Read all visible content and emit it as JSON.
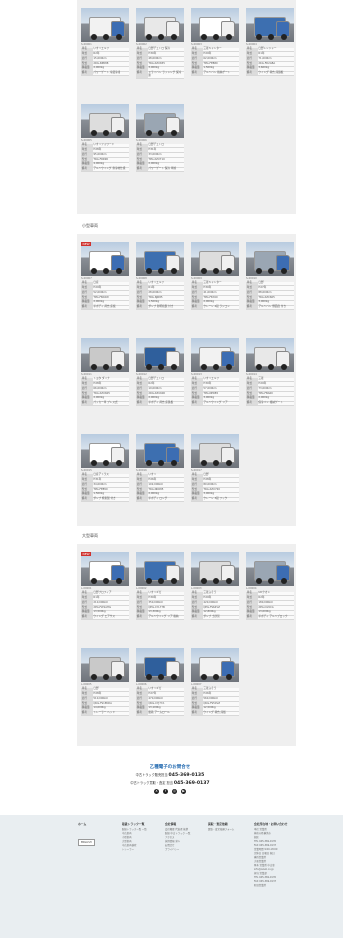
{
  "sections": {
    "used_title": "",
    "small_title": "小型車両",
    "large_title": "大型車両"
  },
  "spec_keys": [
    "車名",
    "年式",
    "走行",
    "型式",
    "積載量",
    "備考"
  ],
  "card_top": [
    {
      "id": "S-00001",
      "vals": [
        "いすゞエルフ",
        "R2年",
        "15,000km",
        "2RG-NPR88",
        "2,000kg",
        "パワーゲート 冷蔵冷凍"
      ]
    },
    {
      "id": "S-00002",
      "vals": [
        "日野デュトロ 保冷",
        "H30年",
        "48,000km",
        "TKG-XZU655",
        "3,000kg",
        "ドライバン ラッシング 保冷庫"
      ]
    },
    {
      "id": "S-00003",
      "vals": [
        "三菱キャンター",
        "H29年",
        "62,000km",
        "TPG-FEB80",
        "1,500kg",
        "アルミバン 格納ゲート"
      ]
    },
    {
      "id": "S-00004",
      "vals": [
        "日野レンジャー",
        "R1年",
        "71,000km",
        "2KG-FD2ABA",
        "3,600kg",
        "ウイング 荷台 床鉄板"
      ]
    },
    {
      "id": "S-00005",
      "vals": [
        "いすゞフォワード",
        "H28年",
        "95,000km",
        "TKG-FRR90",
        "4,000kg",
        "アルミウイング 寒冷地仕様"
      ]
    },
    {
      "id": "S-00006",
      "vals": [
        "日野デュトロ",
        "H31年",
        "33,000km",
        "TPG-XZU710",
        "2,000kg",
        "パワーゲート 保冷 車線"
      ]
    }
  ],
  "card_small": [
    {
      "id": "S-00007",
      "vals": [
        "日産",
        "H29年",
        "52,000km",
        "TPG-FBA5W",
        "2,000kg",
        "平ボディ 荷台 床板"
      ]
    },
    {
      "id": "S-00008",
      "vals": [
        "いすゞエルフ",
        "R1年",
        "28,000km",
        "TRG-NJR85",
        "1,500kg",
        "ダンプ 新明和製 付き"
      ]
    },
    {
      "id": "S-00009",
      "vals": [
        "三菱キャンター",
        "H30年",
        "41,000km",
        "TPG-FEA50",
        "2,000kg",
        "クレーン 4段 ラジコン"
      ]
    },
    {
      "id": "S-00010",
      "vals": [
        "日野",
        "H27年",
        "88,000km",
        "TKG-XZC605",
        "3,000kg",
        "アルミバン 側面扉 付き"
      ]
    },
    {
      "id": "S-00011",
      "vals": [
        "トヨタ ダイナ",
        "H28年",
        "66,000km",
        "TKG-XZU605",
        "2,000kg",
        "パッカー車 プレス式"
      ]
    },
    {
      "id": "S-00012",
      "vals": [
        "日野デュトロ",
        "R2年",
        "19,000km",
        "2RG-XZU600",
        "2,000kg",
        "平ボディ 荷台 床鉄板"
      ]
    },
    {
      "id": "S-00013",
      "vals": [
        "いすゞエルフ",
        "H30年",
        "57,000km",
        "TPG-NPR85",
        "3,000kg",
        "アルミウイング リア"
      ]
    },
    {
      "id": "S-00014",
      "vals": [
        "三菱",
        "H29年",
        "73,000km",
        "TPG-FBA60",
        "2,000kg",
        "保冷バン 格納ゲート"
      ]
    },
    {
      "id": "S-00015",
      "vals": [
        "日産アトラス",
        "H31年",
        "34,000km",
        "TPG-FEB50",
        "1,500kg",
        "ダンプ 極東製 付き"
      ]
    },
    {
      "id": "S-00016",
      "vals": [
        "いすゞ",
        "H26年",
        "102,000km",
        "TKG-NKR85",
        "2,000kg",
        "平ボディ ロング"
      ]
    },
    {
      "id": "S-00017",
      "vals": [
        "日野",
        "H28年",
        "80,000km",
        "TKG-XZU720",
        "3,000kg",
        "クレーン 3段 フック"
      ]
    }
  ],
  "card_large": [
    {
      "id": "L-00001",
      "vals": [
        "日野プロフィア",
        "R1年",
        "210,000km",
        "2PG-FW1AHG",
        "13,500kg",
        "ウイング エアサス"
      ]
    },
    {
      "id": "L-00002",
      "vals": [
        "いすゞギガ",
        "H30年",
        "350,000km",
        "QPG-CYL77B",
        "13,300kg",
        "アルミウイング リア 格納"
      ]
    },
    {
      "id": "L-00003",
      "vals": [
        "三菱ふそう",
        "H29年",
        "420,000km",
        "QPG-FS64VZ",
        "12,800kg",
        "ダンプ 土砂禁"
      ]
    },
    {
      "id": "L-00004",
      "vals": [
        "UDクオン",
        "R2年",
        "180,000km",
        "2PG-CG5CA",
        "13,000kg",
        "平ボディ アルミブロック"
      ]
    },
    {
      "id": "L-00005",
      "vals": [
        "日野",
        "H28年",
        "510,000km",
        "QKG-FS1EKDA",
        "14,000kg",
        "トレーラー ヘッド"
      ]
    },
    {
      "id": "L-00006",
      "vals": [
        "いすゞギガ",
        "H27年",
        "470,000km",
        "QKG-CYJ77A",
        "13,100kg",
        "脱着 アームロール"
      ]
    },
    {
      "id": "L-00007",
      "vals": [
        "三菱ふそう",
        "H26年",
        "560,000km",
        "QKG-FS54VZ",
        "12,500kg",
        "ウイング 荷台 床板"
      ]
    }
  ],
  "contact": {
    "title": "乙種電子のお問合せ",
    "line1_label": "中古トラック販売担当",
    "line1_tel": "045-369-0135",
    "line2_label": "中古トラック買取・査定 担当",
    "line2_tel": "045-369-0137"
  },
  "sns": [
    "X",
    "f",
    "◎",
    "▶"
  ],
  "footer": {
    "col1": {
      "head": "ホーム",
      "items": [
        "ENGLISH"
      ]
    },
    "col2": {
      "head": "取扱トラック一覧",
      "items": [
        "取扱トラック一覧 一覧",
        "中古車両",
        "小型車両",
        "大型車両",
        "中古車両検索",
        "トレーラー"
      ]
    },
    "col3": {
      "head": "会社情報",
      "items": [
        "会社概要 代表者 挨拶",
        "取扱 中古トラック 一覧",
        "アクセス",
        "採用情報 求人",
        "お問合せ",
        "プライバシー"
      ]
    },
    "col4": {
      "head": "買取・査定依頼",
      "items": [
        "買取・査定依頼フォーム"
      ]
    },
    "col5": {
      "head": "会社所在地・お問い合わせ",
      "items": [
        "本社 営業所",
        "神奈川県横浜市",
        "旭区",
        "TEL 045-369-0135",
        "FAX 045-369-0137",
        "営業時間 9:00-18:00",
        "定休日 日曜日 祝日",
        "横浜営業所",
        "大和営業所",
        "厚木 営業所 中古車",
        "info@ozuki.co.jp",
        "担当 営業部",
        "TEL 045-369-0135",
        "FAX 045-369-0137",
        "町田営業所"
      ]
    }
  }
}
